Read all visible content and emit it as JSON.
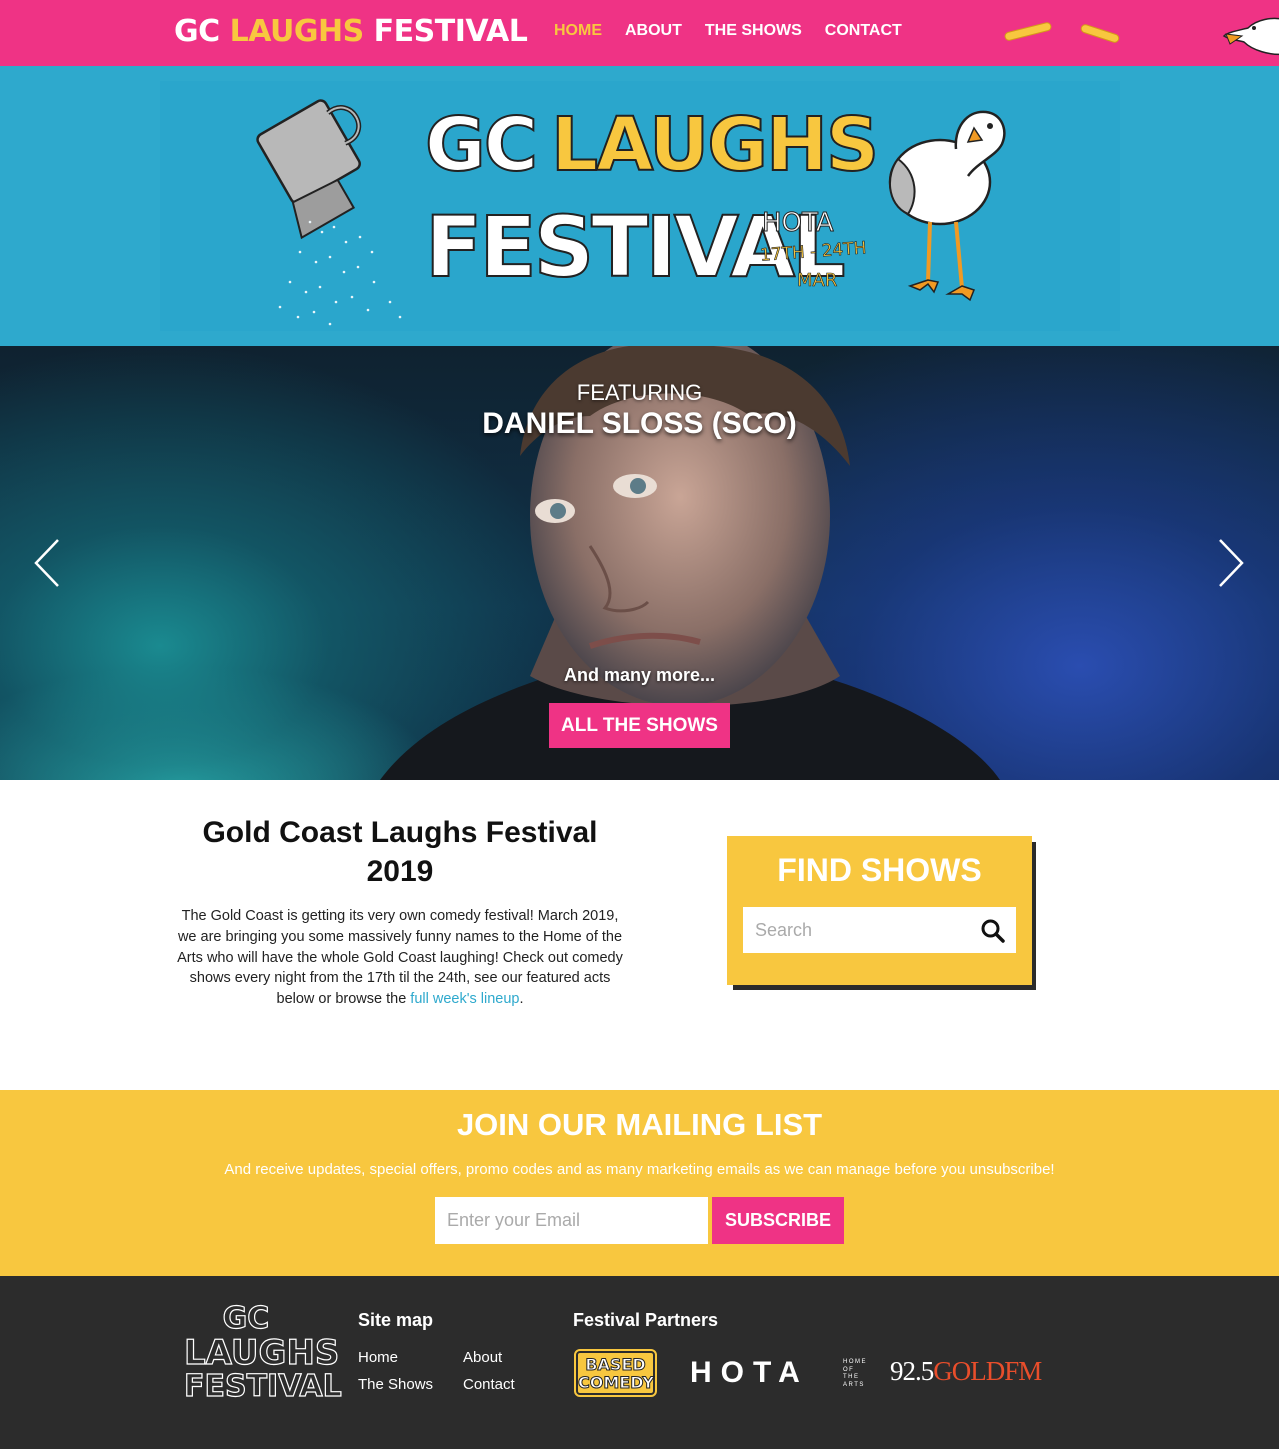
{
  "nav": {
    "logo": {
      "part1": "GC",
      "part2": "LAUGHS",
      "part3": "FESTIVAL"
    },
    "links": [
      "HOME",
      "ABOUT",
      "THE SHOWS",
      "CONTACT"
    ],
    "active": "HOME"
  },
  "banner": {
    "title_gc": "GC",
    "title_laughs": "LAUGHS",
    "title_festival": "FESTIVAL",
    "venue": "HOTA",
    "dates": "17TH - 24TH",
    "month": "MAR"
  },
  "hero": {
    "featuring": "FEATURING",
    "name": "DANIEL SLOSS (SCO)",
    "more": "And many more...",
    "button": "ALL THE SHOWS"
  },
  "intro": {
    "title": "Gold Coast Laughs Festival 2019",
    "body": "The Gold Coast is getting its very own comedy festival! March 2019, we are bringing you some massively funny names to the Home of the Arts who will have the whole Gold Coast laughing! Check out comedy shows every night from the 17th til the 24th, see our featured acts below or browse the ",
    "link": "full week's lineup",
    "end": "."
  },
  "find": {
    "title": "FIND SHOWS",
    "placeholder": "Search"
  },
  "mailing": {
    "title": "JOIN OUR MAILING LIST",
    "subtitle": "And receive updates, special offers, promo codes and as many marketing emails as we can manage before you unsubscribe!",
    "placeholder": "Enter your Email",
    "button": "SUBSCRIBE"
  },
  "footer": {
    "logo": {
      "l1": "GC",
      "l2": "LAUGHS",
      "l3": "FESTIVAL"
    },
    "sitemap_title": "Site map",
    "sitemap": [
      "Home",
      "About",
      "The Shows",
      "Contact"
    ],
    "partners_title": "Festival Partners",
    "partners": {
      "based_l1": "BASED",
      "based_l2": "COMEDY",
      "hota": "HOTA",
      "hota_sub": "HOME OF THE ARTS",
      "gold_num": "92.5",
      "gold_name": "GOLDFM"
    }
  },
  "colors": {
    "pink": "#ef3385",
    "yellow": "#f8c73f",
    "blue": "#2ea9cd",
    "dark": "#2c2c2c"
  },
  "icons": [
    "chevron-left-icon",
    "chevron-right-icon",
    "search-icon",
    "fry-icon",
    "seagull-icon",
    "watering-can-icon"
  ]
}
